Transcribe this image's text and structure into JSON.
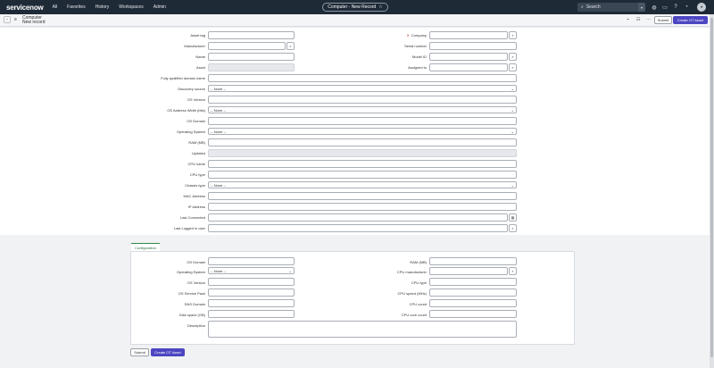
{
  "nav": {
    "brand": "servicenow",
    "items": [
      "All",
      "Favorites",
      "History",
      "Workspaces",
      "Admin"
    ],
    "record_pill": "Computer - New Record",
    "search_placeholder": "Search"
  },
  "header": {
    "title": "Computer",
    "subtitle": "New record",
    "submit_label": "Submit",
    "primary_label": "Create OT Asset"
  },
  "form": {
    "left": [
      {
        "label": "Asset tag",
        "value": ""
      },
      {
        "label": "Manufacturer",
        "value": ""
      },
      {
        "label": "Name",
        "value": ""
      },
      {
        "label": "Asset",
        "value": ""
      }
    ],
    "right": [
      {
        "label": "Company",
        "value": "",
        "required": true
      },
      {
        "label": "Serial number",
        "value": ""
      },
      {
        "label": "Model ID",
        "value": ""
      },
      {
        "label": "Assigned to",
        "value": ""
      }
    ],
    "full": [
      {
        "label": "Fully qualified domain name",
        "value": ""
      },
      {
        "label": "Discovery source",
        "value": "-- None --"
      },
      {
        "label": "OS Version",
        "value": ""
      },
      {
        "label": "OS Address Width (bits)",
        "value": "-- None --"
      },
      {
        "label": "OS Domain",
        "value": ""
      },
      {
        "label": "Operating System",
        "value": "-- None --"
      },
      {
        "label": "RAM (MB)",
        "value": ""
      },
      {
        "label": "Updated",
        "value": ""
      },
      {
        "label": "CPU name",
        "value": ""
      },
      {
        "label": "CPU type",
        "value": ""
      },
      {
        "label": "Chassis type",
        "value": "-- None --"
      },
      {
        "label": "MAC Address",
        "value": ""
      },
      {
        "label": "IP Address",
        "value": ""
      },
      {
        "label": "Last Connected",
        "value": ""
      },
      {
        "label": "Last Logged in user",
        "value": ""
      }
    ]
  },
  "config": {
    "tab_label": "Configuration",
    "left": [
      {
        "label": "OS Domain",
        "value": ""
      },
      {
        "label": "Operating System",
        "value": "-- None --"
      },
      {
        "label": "OS Version",
        "value": ""
      },
      {
        "label": "OS Service Pack",
        "value": ""
      },
      {
        "label": "DNS Domain",
        "value": ""
      },
      {
        "label": "Disk space (GB)",
        "value": ""
      }
    ],
    "right": [
      {
        "label": "RAM (MB)",
        "value": ""
      },
      {
        "label": "CPU manufacturer",
        "value": ""
      },
      {
        "label": "CPU type",
        "value": ""
      },
      {
        "label": "CPU speed (MHz)",
        "value": ""
      },
      {
        "label": "CPU count",
        "value": ""
      },
      {
        "label": "CPU core count",
        "value": ""
      }
    ],
    "description_label": "Description",
    "submit_label": "Submit",
    "primary_label": "Create OT Asset"
  },
  "colors": {
    "nav_bg": "#1f2a37",
    "primary_button": "#4c46c2",
    "tab_accent": "#2f8a4a",
    "required_mark": "#c0392b"
  },
  "icons": {
    "lookup": "search-icon",
    "calendar": "calendar-icon",
    "back": "chevron-left-icon"
  }
}
